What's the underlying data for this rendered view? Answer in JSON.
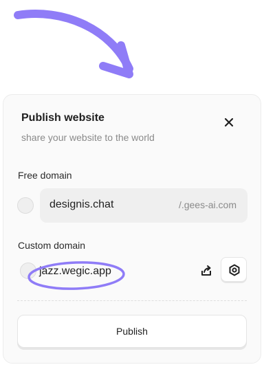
{
  "dialog": {
    "title": "Publish website",
    "subtitle": "share your website to the world",
    "close_icon": "close-icon"
  },
  "free_domain": {
    "label": "Free domain",
    "name": "designis.chat",
    "suffix": "/.gees-ai.com",
    "selected": false
  },
  "custom_domain": {
    "label": "Custom domain",
    "value": "jazz.wegic.app",
    "selected": false,
    "share_icon": "share-icon",
    "settings_icon": "settings-icon"
  },
  "actions": {
    "publish_label": "Publish"
  },
  "colors": {
    "accent": "#8f7cf7",
    "card_bg": "#fafafa",
    "input_bg": "#efefef",
    "muted_text": "#8a8a8a"
  }
}
